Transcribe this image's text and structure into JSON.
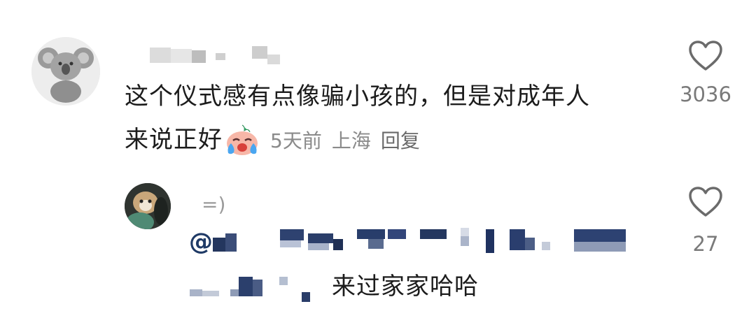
{
  "comment": {
    "text_line1": "这个仪式感有点像骗小孩的，但是对成年人",
    "text_line2": "来说正好",
    "time": "5天前",
    "location": "上海",
    "reply_label": "回复",
    "like_count": "3036",
    "emoji": "crying-laughing-face"
  },
  "reply": {
    "username": "=)",
    "mention_prefix": "@",
    "text": "来过家家哈哈",
    "like_count": "27"
  }
}
